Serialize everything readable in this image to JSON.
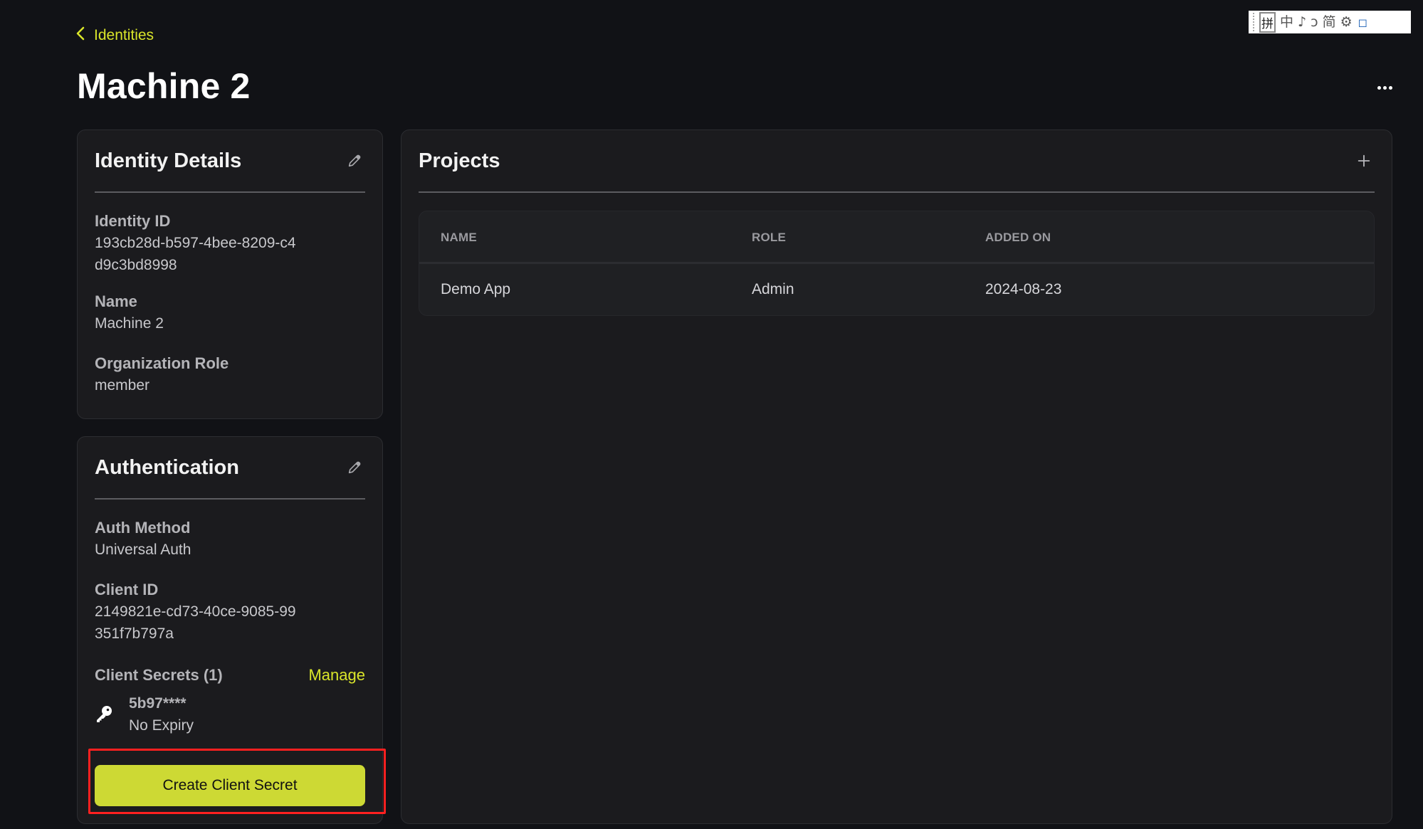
{
  "breadcrumb": {
    "label": "Identities",
    "icon": "chevron-left-icon"
  },
  "page": {
    "title": "Machine 2",
    "more_icon": "ellipsis-icon"
  },
  "ime_toolbar": {
    "items": [
      "拼",
      "中",
      "♪",
      "ↄ",
      "简",
      "⚙",
      "◻"
    ]
  },
  "identity_details": {
    "title": "Identity Details",
    "edit_icon": "pencil-icon",
    "fields": [
      {
        "label": "Identity ID",
        "value": "193cb28d-b597-4bee-8209-c4d9c3bd8998"
      },
      {
        "label": "Name",
        "value": "Machine 2"
      },
      {
        "label": "Organization Role",
        "value": "member"
      }
    ]
  },
  "authentication": {
    "title": "Authentication",
    "edit_icon": "pencil-icon",
    "fields": [
      {
        "label": "Auth Method",
        "value": "Universal Auth"
      },
      {
        "label": "Client ID",
        "value": "2149821e-cd73-40ce-9085-99351f7b797a"
      }
    ],
    "client_secrets_label": "Client Secrets (1)",
    "manage_label": "Manage",
    "secrets": [
      {
        "id": "5b97****",
        "expiry": "No Expiry",
        "icon": "key-icon"
      }
    ],
    "create_button_label": "Create Client Secret"
  },
  "projects": {
    "title": "Projects",
    "add_icon": "plus-icon",
    "columns": [
      "NAME",
      "ROLE",
      "ADDED ON"
    ],
    "rows": [
      {
        "name": "Demo App",
        "role": "Admin",
        "added_on": "2024-08-23"
      }
    ]
  },
  "colors": {
    "accent": "#d9e52a",
    "button": "#cdd934",
    "background": "#111216",
    "card": "#1b1b1e",
    "annotation": "#ff2020"
  }
}
